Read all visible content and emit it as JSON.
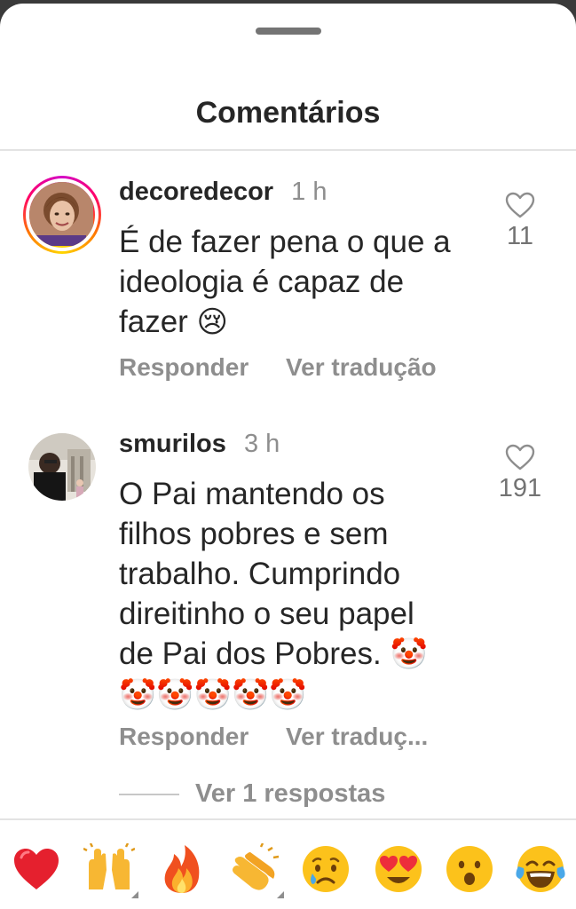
{
  "sheet": {
    "title": "Comentários"
  },
  "comments": [
    {
      "username": "decoredecor",
      "time": "1 h",
      "text": "É de fazer pena o que a ideologia é capaz de fazer",
      "text_emoji": "😢",
      "likes": "11",
      "reply_label": "Responder",
      "translate_label": "Ver tradução"
    },
    {
      "username": "smurilos",
      "time": "3 h",
      "text": "O Pai mantendo os filhos pobres e sem trabalho. Cumprindo direitinho o seu papel de Pai dos Pobres.",
      "text_emoji": "🤡 🤡🤡🤡🤡🤡",
      "likes": "191",
      "reply_label": "Responder",
      "translate_label": "Ver traduç..."
    }
  ],
  "replies_link": "Ver 1 respostas",
  "quick_reactions": [
    {
      "icon": "red-heart-icon"
    },
    {
      "icon": "raising-hands-icon"
    },
    {
      "icon": "fire-icon"
    },
    {
      "icon": "clapping-hands-icon"
    },
    {
      "icon": "crying-face-icon"
    },
    {
      "icon": "heart-eyes-face-icon"
    },
    {
      "icon": "surprised-face-icon"
    },
    {
      "icon": "tears-of-joy-face-icon"
    }
  ],
  "colors": {
    "text": "#262626",
    "secondary": "#8e8e8e",
    "divider": "#e3e3e3"
  }
}
